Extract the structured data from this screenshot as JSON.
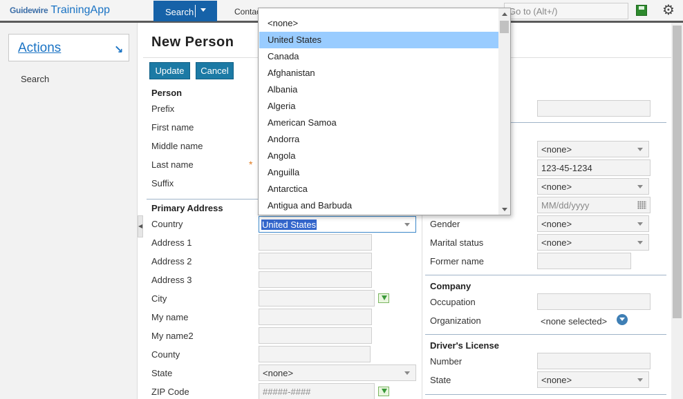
{
  "app": {
    "brand": "Guidewire",
    "title": "TrainingApp"
  },
  "tabs": {
    "search": "Search",
    "contacts": "Contac"
  },
  "goto": {
    "placeholder": "Go to (Alt+/)"
  },
  "sidebar": {
    "actions_label": "Actions",
    "search_label": "Search"
  },
  "page": {
    "title": "New Person"
  },
  "buttons": {
    "update": "Update",
    "cancel": "Cancel"
  },
  "person": {
    "section": "Person",
    "prefix": "Prefix",
    "first_name": "First name",
    "middle_name": "Middle name",
    "last_name": "Last name",
    "required_marker": "*",
    "suffix": "Suffix"
  },
  "address": {
    "section": "Primary Address",
    "country_label": "Country",
    "country_value": "United States",
    "address1": "Address 1",
    "address2": "Address 2",
    "address3": "Address 3",
    "city": "City",
    "my_name": "My name",
    "my_name2": "My name2",
    "county": "County",
    "state_label": "State",
    "state_value": "<none>",
    "zip_label": "ZIP Code",
    "zip_placeholder": "#####-####"
  },
  "right": {
    "select1_value": "<none>",
    "ssn_value": "123-45-1234",
    "select2_value": "<none>",
    "date_placeholder": "MM/dd/yyyy",
    "gender_label": "Gender",
    "gender_value": "<none>",
    "marital_label": "Marital status",
    "marital_value": "<none>",
    "former_name_label": "Former name",
    "company_section": "Company",
    "occupation_label": "Occupation",
    "organization_label": "Organization",
    "organization_value": "<none selected>",
    "license_section": "Driver's License",
    "number_label": "Number",
    "state_label": "State",
    "state_value": "<none>"
  },
  "country_dropdown": {
    "items": [
      "<none>",
      "United States",
      "Canada",
      "Afghanistan",
      "Albania",
      "Algeria",
      "American Samoa",
      "Andorra",
      "Angola",
      "Anguilla",
      "Antarctica",
      "Antigua and Barbuda"
    ],
    "selected": "United States"
  },
  "colors": {
    "brand_blue": "#1662a8",
    "button_teal": "#1c7aa5",
    "highlight": "#99ccff",
    "required": "#e07b20"
  }
}
